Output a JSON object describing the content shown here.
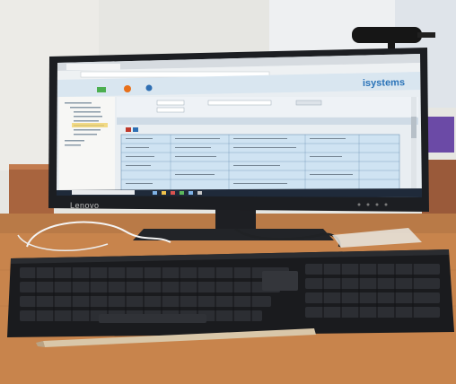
{
  "photo": {
    "monitor": {
      "brand": "Lenovo",
      "screen": {
        "browser": {
          "brand_logo": "isystems"
        }
      }
    }
  },
  "colors": {
    "wall": "#e6e6e2",
    "desk": "#c8844c",
    "monitor_bezel": "#1c1e22",
    "keyboard": "#1a1b1e",
    "app_header": "#2a73b8",
    "screen_bg": "#e9eef2",
    "pencil": "#d9c7a9"
  }
}
